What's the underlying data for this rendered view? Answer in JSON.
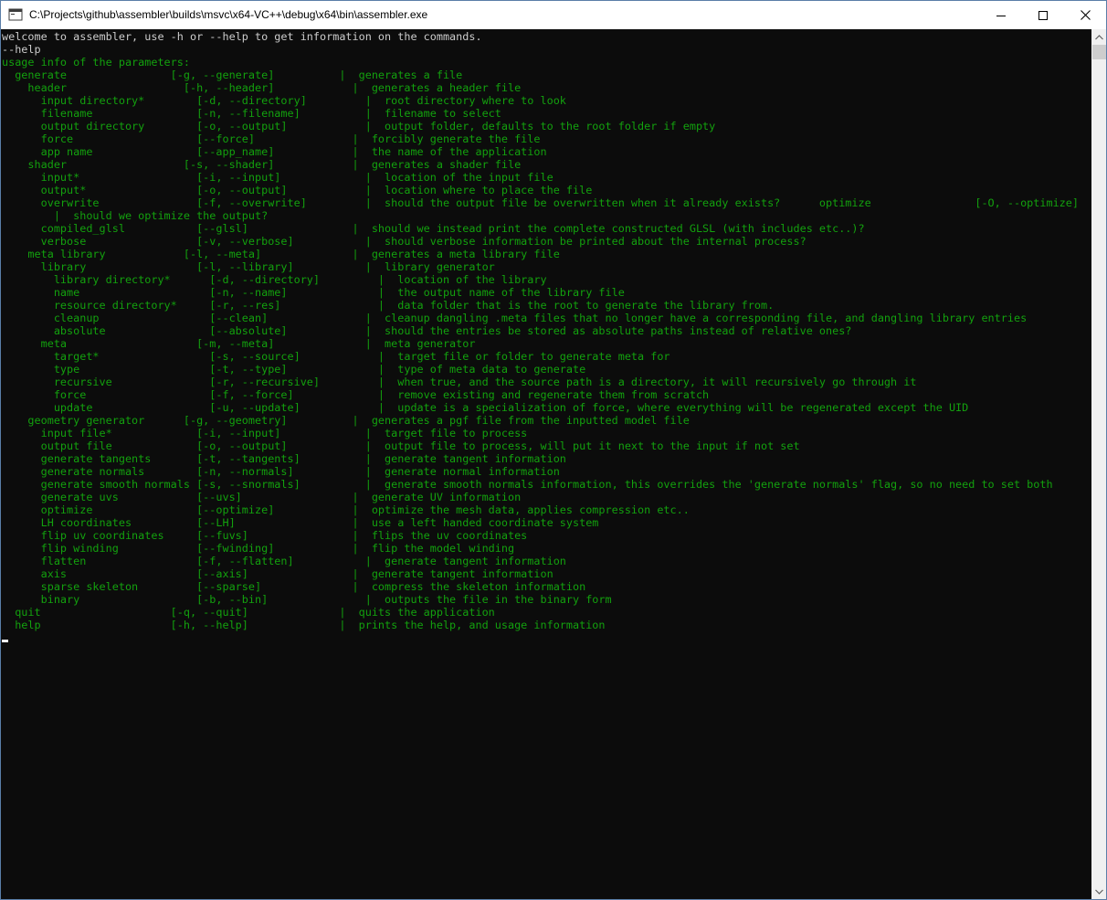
{
  "window": {
    "title": "C:\\Projects\\github\\assembler\\builds\\msvc\\x64-VC++\\debug\\x64\\bin\\assembler.exe",
    "icon": "console-app-icon"
  },
  "console": {
    "text_color": "#13a10e",
    "plain_color": "#cccccc",
    "background": "#0c0c0c",
    "welcome_line": "welcome to assembler, use -h or --help to get information on the commands.",
    "command_line": "--help",
    "lines": [
      "usage info of the parameters:",
      "  generate                [-g, --generate]          |  generates a file",
      "    header                  [-h, --header]            |  generates a header file",
      "      input directory*        [-d, --directory]         |  root directory where to look",
      "      filename                [-n, --filename]          |  filename to select",
      "      output directory        [-o, --output]            |  output folder, defaults to the root folder if empty",
      "      force                   [--force]               |  forcibly generate the file",
      "      app name                [--app_name]            |  the name of the application",
      "    shader                  [-s, --shader]            |  generates a shader file",
      "      input*                  [-i, --input]             |  location of the input file",
      "      output*                 [-o, --output]            |  location where to place the file",
      "      overwrite               [-f, --overwrite]         |  should the output file be overwritten when it already exists?      optimize                [-O, --optimize]",
      "        |  should we optimize the output?",
      "      compiled_glsl           [--glsl]                |  should we instead print the complete constructed GLSL (with includes etc..)?",
      "      verbose                 [-v, --verbose]           |  should verbose information be printed about the internal process?",
      "    meta library            [-l, --meta]              |  generates a meta library file",
      "      library                 [-l, --library]           |  library generator",
      "        library directory*      [-d, --directory]         |  location of the library",
      "        name                    [-n, --name]              |  the output name of the library file",
      "        resource directory*     [-r, --res]               |  data folder that is the root to generate the library from.",
      "        cleanup                 [--clean]               |  cleanup dangling .meta files that no longer have a corresponding file, and dangling library entries",
      "        absolute                [--absolute]            |  should the entries be stored as absolute paths instead of relative ones?",
      "      meta                    [-m, --meta]              |  meta generator",
      "        target*                 [-s, --source]            |  target file or folder to generate meta for",
      "        type                    [-t, --type]              |  type of meta data to generate",
      "        recursive               [-r, --recursive]         |  when true, and the source path is a directory, it will recursively go through it",
      "        force                   [-f, --force]             |  remove existing and regenerate them from scratch",
      "        update                  [-u, --update]            |  update is a specialization of force, where everything will be regenerated except the UID",
      "    geometry generator      [-g, --geometry]          |  generates a pgf file from the inputted model file",
      "      input file*             [-i, --input]             |  target file to process",
      "      output file             [-o, --output]            |  output file to process, will put it next to the input if not set",
      "      generate tangents       [-t, --tangents]          |  generate tangent information",
      "      generate normals        [-n, --normals]           |  generate normal information",
      "      generate smooth normals [-s, --snormals]          |  generate smooth normals information, this overrides the 'generate normals' flag, so no need to set both",
      "      generate uvs            [--uvs]                 |  generate UV information",
      "      optimize                [--optimize]            |  optimize the mesh data, applies compression etc..",
      "      LH coordinates          [--LH]                  |  use a left handed coordinate system",
      "      flip uv coordinates     [--fuvs]                |  flips the uv coordinates",
      "      flip winding            [--fwinding]            |  flip the model winding",
      "      flatten                 [-f, --flatten]           |  generate tangent information",
      "      axis                    [--axis]                |  generate tangent information",
      "      sparse skeleton         [--sparse]              |  compress the skeleton information",
      "      binary                  [-b, --bin]               |  outputs the file in the binary form",
      "  quit                    [-q, --quit]              |  quits the application",
      "  help                    [-h, --help]              |  prints the help, and usage information"
    ]
  }
}
